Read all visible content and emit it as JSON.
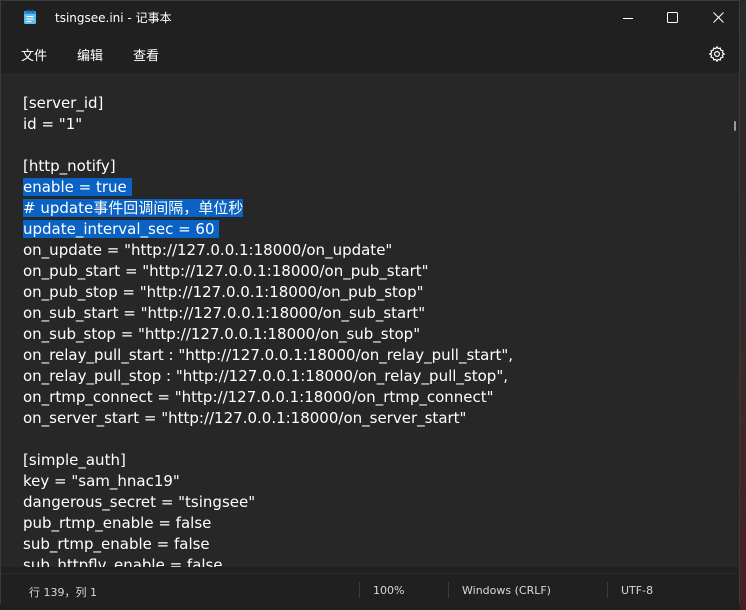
{
  "window": {
    "title": "tsingsee.ini - 记事本",
    "app_icon": "notepad-icon"
  },
  "caption_buttons": {
    "minimize": "minimize-icon",
    "maximize": "maximize-icon",
    "close": "close-icon"
  },
  "menu": {
    "file": "文件",
    "edit": "编辑",
    "view": "查看",
    "settings_icon": "gear-icon"
  },
  "editor": {
    "lines": [
      {
        "text": "[server_id]",
        "selected": false
      },
      {
        "text": "id = \"1\"",
        "selected": false
      },
      {
        "text": "",
        "selected": false
      },
      {
        "text": "[http_notify]",
        "selected": false
      },
      {
        "text": "enable = true ",
        "selected": true
      },
      {
        "text": "# update事件回调间隔，单位秒",
        "selected": true
      },
      {
        "text": "update_interval_sec = 60 ",
        "selected": true
      },
      {
        "text": "on_update = \"http://127.0.0.1:18000/on_update\"",
        "selected": false
      },
      {
        "text": "on_pub_start = \"http://127.0.0.1:18000/on_pub_start\"",
        "selected": false
      },
      {
        "text": "on_pub_stop = \"http://127.0.0.1:18000/on_pub_stop\"",
        "selected": false
      },
      {
        "text": "on_sub_start = \"http://127.0.0.1:18000/on_sub_start\"",
        "selected": false
      },
      {
        "text": "on_sub_stop = \"http://127.0.0.1:18000/on_sub_stop\"",
        "selected": false
      },
      {
        "text": "on_relay_pull_start : \"http://127.0.0.1:18000/on_relay_pull_start\",",
        "selected": false
      },
      {
        "text": "on_relay_pull_stop : \"http://127.0.0.1:18000/on_relay_pull_stop\",",
        "selected": false
      },
      {
        "text": "on_rtmp_connect = \"http://127.0.0.1:18000/on_rtmp_connect\"",
        "selected": false
      },
      {
        "text": "on_server_start = \"http://127.0.0.1:18000/on_server_start\"",
        "selected": false
      },
      {
        "text": "",
        "selected": false
      },
      {
        "text": "[simple_auth]",
        "selected": false
      },
      {
        "text": "key = \"sam_hnac19\"",
        "selected": false
      },
      {
        "text": "dangerous_secret = \"tsingsee\"",
        "selected": false
      },
      {
        "text": "pub_rtmp_enable = false",
        "selected": false
      },
      {
        "text": "sub_rtmp_enable = false",
        "selected": false
      },
      {
        "text": "sub_httpflv_enable = false",
        "selected": false
      }
    ],
    "selection_color": "#0a62c4"
  },
  "status": {
    "position": "行 139，列 1",
    "zoom": "100%",
    "line_ending": "Windows (CRLF)",
    "encoding": "UTF-8"
  },
  "colors": {
    "chrome_bg": "#202020",
    "editor_bg": "#272727",
    "text": "#ffffff"
  }
}
